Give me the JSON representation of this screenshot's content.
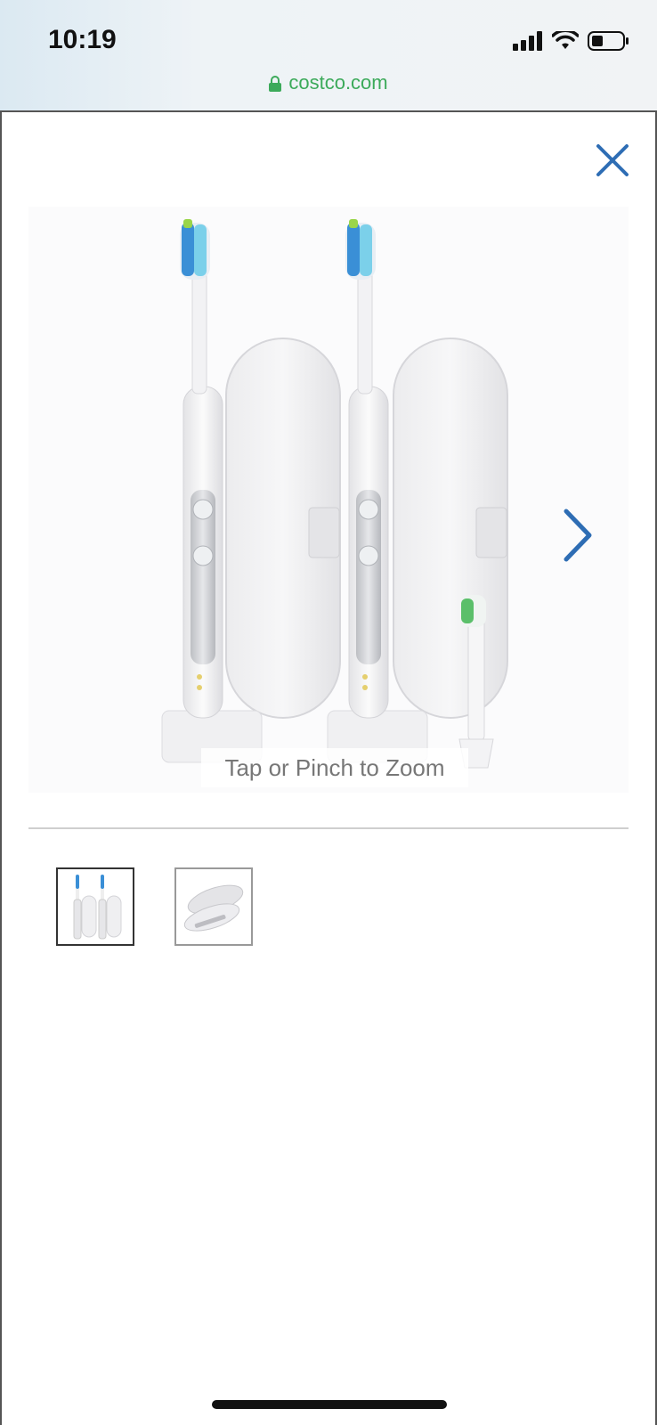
{
  "status_bar": {
    "time": "10:19",
    "url": "costco.com",
    "icons": [
      "signal-icon",
      "wifi-icon",
      "battery-icon"
    ]
  },
  "viewer": {
    "close_icon": "close-icon",
    "next_icon": "chevron-right-icon",
    "zoom_hint": "Tap or Pinch to Zoom",
    "main_image_alt": "Two white electric toothbrushes with travel cases",
    "thumbnails": [
      {
        "name": "thumbnail-toothbrushes",
        "active": true
      },
      {
        "name": "thumbnail-travel-case",
        "active": false
      }
    ]
  },
  "colors": {
    "accent_blue": "#2e6db4",
    "url_green": "#3caa5a"
  }
}
